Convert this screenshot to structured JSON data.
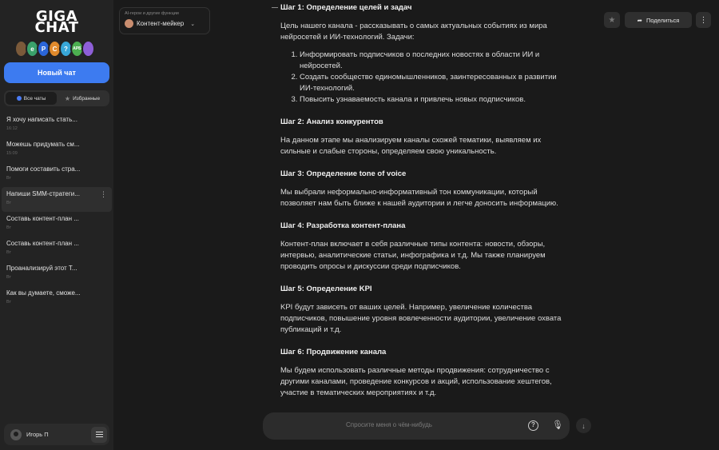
{
  "logo": {
    "line1": "GIGA",
    "line2": "CHAT"
  },
  "avatars": [
    {
      "label": "",
      "color": "#7b5a3a"
    },
    {
      "label": "e",
      "color": "#3aa16b"
    },
    {
      "label": "P",
      "color": "#2b66d9"
    },
    {
      "label": "C",
      "color": "#e08a2c"
    },
    {
      "label": "?",
      "color": "#38a7d8"
    },
    {
      "label": "АРБ",
      "color": "#4caf50"
    },
    {
      "label": "",
      "color": "#8e5fd8"
    }
  ],
  "sidebar": {
    "new_chat": "Новый чат",
    "filter_all": "Все чаты",
    "filter_fav": "Избранные",
    "chats": [
      {
        "title": "Я хочу написать стать...",
        "time": "16:12"
      },
      {
        "title": "Можешь придумать см...",
        "time": "15:09"
      },
      {
        "title": "Помоги составить стра...",
        "time": "Вт"
      },
      {
        "title": "Напиши SMM-стратеги...",
        "time": "Вт"
      },
      {
        "title": "Составь контент-план ...",
        "time": "Вт"
      },
      {
        "title": "Составь контент-план ...",
        "time": "Вт"
      },
      {
        "title": "Проанализируй этот Т...",
        "time": "Вт"
      },
      {
        "title": "Как вы думаете, сможе...",
        "time": "Вт"
      }
    ],
    "user_name": "Игорь П"
  },
  "model": {
    "caption": "AI-герои и другие функции",
    "name": "Контент-мейкер"
  },
  "topbar": {
    "share": "Поделиться"
  },
  "content": {
    "step1_title": "Шаг 1: Определение целей и задач",
    "step1_text": "Цель нашего канала - рассказывать о самых актуальных событиях из мира нейросетей и ИИ-технологий. Задачи:",
    "step1_items": [
      "Информировать подписчиков о последних новостях в области ИИ и нейросетей.",
      "Создать сообщество единомышленников, заинтересованных в развитии ИИ-технологий.",
      "Повысить узнаваемость канала и привлечь новых подписчиков."
    ],
    "step2_title": "Шаг 2: Анализ конкурентов",
    "step2_text": "На данном этапе мы анализируем каналы схожей тематики, выявляем их сильные и слабые стороны, определяем свою уникальность.",
    "step3_title": "Шаг 3: Определение tone of voice",
    "step3_text": "Мы выбрали неформально-информативный тон коммуникации, который позволяет нам быть ближе к нашей аудитории и легче доносить информацию.",
    "step4_title": "Шаг 4: Разработка контент-плана",
    "step4_text": "Контент-план включает в себя различные типы контента: новости, обзоры, интервью, аналитические статьи, инфографика и т.д. Мы также планируем проводить опросы и дискуссии среди подписчиков.",
    "step5_title": "Шаг 5: Определение KPI",
    "step5_text": "KPI будут зависеть от ваших целей. Например, увеличение количества подписчиков, повышение уровня вовлеченности аудитории, увеличение охвата публикаций и т.д.",
    "step6_title": "Шаг 6: Продвижение канала",
    "step6_text": "Мы будем использовать различные методы продвижения: сотрудничество с другими каналами, проведение конкурсов и акций, использование хештегов, участие в тематических мероприятиях и т.д."
  },
  "input": {
    "placeholder": "Спросите меня о чём-нибудь"
  }
}
